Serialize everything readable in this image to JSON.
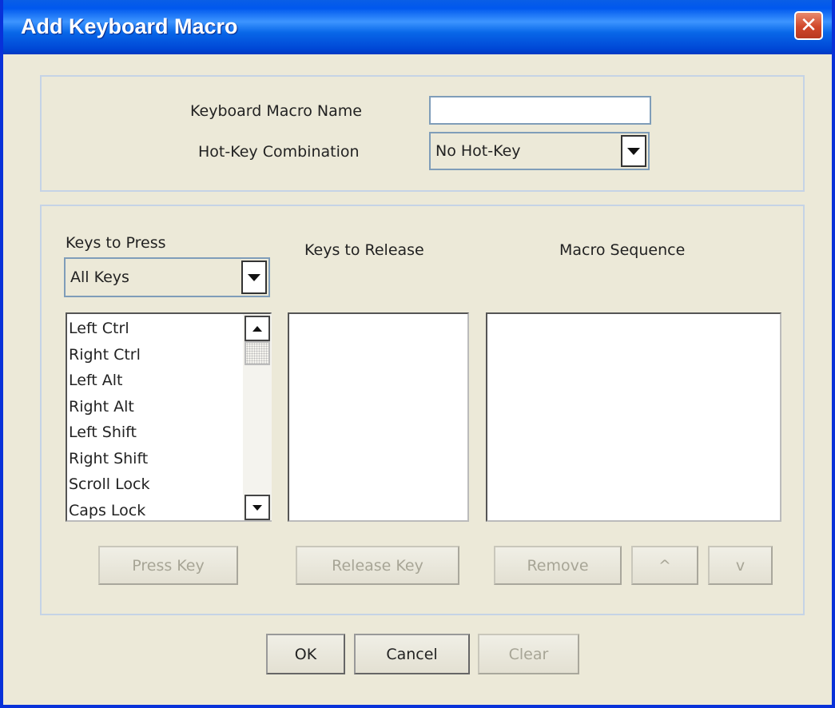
{
  "window": {
    "title": "Add Keyboard Macro",
    "close_glyph": "✕"
  },
  "top_panel": {
    "macro_name_label": "Keyboard Macro Name",
    "macro_name_value": "",
    "hotkey_label": "Hot-Key Combination",
    "hotkey_value": "No Hot-Key"
  },
  "keys_to_press": {
    "label": "Keys to Press",
    "filter_value": "All Keys",
    "items": [
      "Left Ctrl",
      "Right Ctrl",
      "Left Alt",
      "Right Alt",
      "Left Shift",
      "Right Shift",
      "Scroll Lock",
      "Caps Lock"
    ],
    "button": "Press Key"
  },
  "keys_to_release": {
    "label": "Keys to Release",
    "items": [],
    "button": "Release Key"
  },
  "macro_sequence": {
    "label": "Macro Sequence",
    "items": [],
    "remove_button": "Remove",
    "up_button": "^",
    "down_button": "v"
  },
  "footer": {
    "ok": "OK",
    "cancel": "Cancel",
    "clear": "Clear"
  }
}
